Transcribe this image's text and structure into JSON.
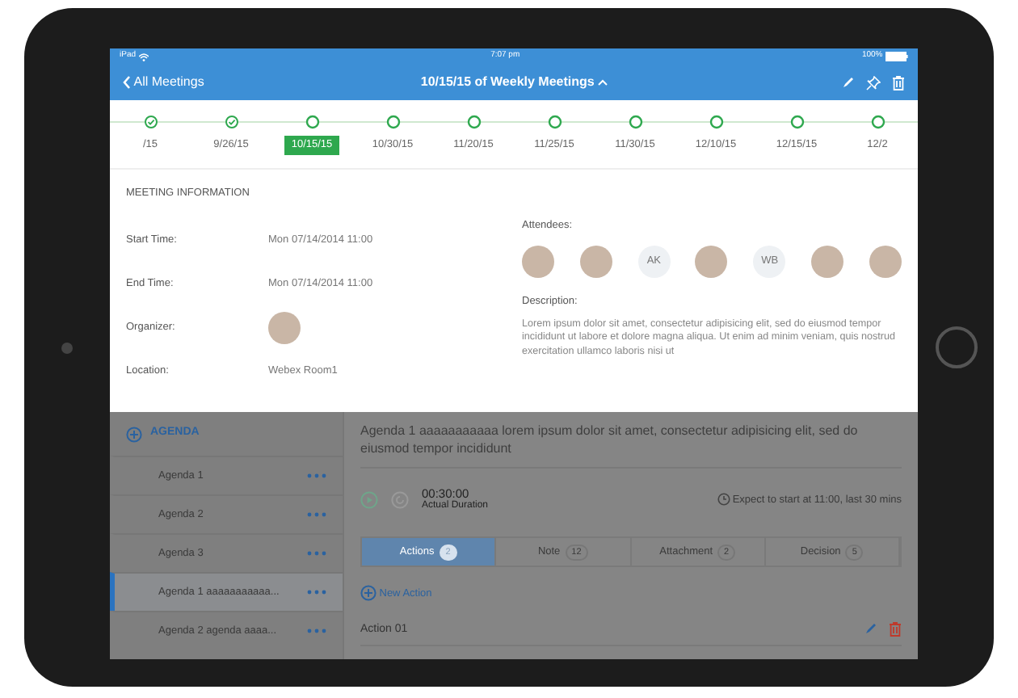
{
  "status_bar": {
    "device": "iPad",
    "time": "7:07 pm",
    "battery": "100%"
  },
  "nav": {
    "back": "All Meetings",
    "title": "10/15/15 of Weekly Meetings"
  },
  "timeline": [
    {
      "date": "/15",
      "done": true,
      "selected": false
    },
    {
      "date": "9/26/15",
      "done": true,
      "selected": false
    },
    {
      "date": "10/15/15",
      "done": false,
      "selected": true
    },
    {
      "date": "10/30/15",
      "done": false,
      "selected": false
    },
    {
      "date": "11/20/15",
      "done": false,
      "selected": false
    },
    {
      "date": "11/25/15",
      "done": false,
      "selected": false
    },
    {
      "date": "11/30/15",
      "done": false,
      "selected": false
    },
    {
      "date": "12/10/15",
      "done": false,
      "selected": false
    },
    {
      "date": "12/15/15",
      "done": false,
      "selected": false
    },
    {
      "date": "12/2",
      "done": false,
      "selected": false
    }
  ],
  "meeting_info": {
    "heading": "MEETING INFORMATION",
    "fields": [
      {
        "label": "Start Time:",
        "kind": "text",
        "value": "Mon 07/14/2014 11:00"
      },
      {
        "label": "End Time:",
        "kind": "text",
        "value": "Mon 07/14/2014 11:00"
      },
      {
        "label": "Organizer:",
        "kind": "avatar"
      },
      {
        "label": "Location:",
        "kind": "text",
        "value": "Webex Room1"
      }
    ],
    "attendees_label": "Attendees:",
    "attendees": [
      {
        "kind": "photo"
      },
      {
        "kind": "photo"
      },
      {
        "kind": "initials",
        "initials": "AK"
      },
      {
        "kind": "photo"
      },
      {
        "kind": "initials",
        "initials": "WB"
      },
      {
        "kind": "photo"
      },
      {
        "kind": "photo"
      }
    ],
    "description_label": "Description:",
    "description": "Lorem ipsum dolor sit amet, consectetur adipisicing elit, sed do eiusmod tempor incididunt ut labore et dolore magna aliqua. Ut enim ad minim veniam, quis nostrud exercitation ullamco laboris nisi ut"
  },
  "agenda": {
    "heading": "AGENDA",
    "items": [
      {
        "label": "Agenda 1",
        "selected": false
      },
      {
        "label": "Agenda 2",
        "selected": false
      },
      {
        "label": "Agenda 3",
        "selected": false
      },
      {
        "label": "Agenda 1 aaaaaaaaaaa...",
        "selected": true
      },
      {
        "label": "Agenda 2 agenda aaaa...",
        "selected": false
      }
    ]
  },
  "detail": {
    "title": "Agenda 1 aaaaaaaaaaa lorem ipsum dolor sit amet, consectetur adipisicing elit, sed do eiusmod tempor incididunt",
    "timer": "00:30:00",
    "timer_label": "Actual Duration",
    "expect": "Expect to start at 11:00, last 30 mins",
    "tabs": [
      {
        "label": "Actions",
        "count": "2",
        "selected": true
      },
      {
        "label": "Note",
        "count": "12",
        "selected": false
      },
      {
        "label": "Attachment",
        "count": "2",
        "selected": false
      },
      {
        "label": "Decision",
        "count": "5",
        "selected": false
      }
    ],
    "new_action": "New Action",
    "actions": [
      "Action 01"
    ]
  }
}
